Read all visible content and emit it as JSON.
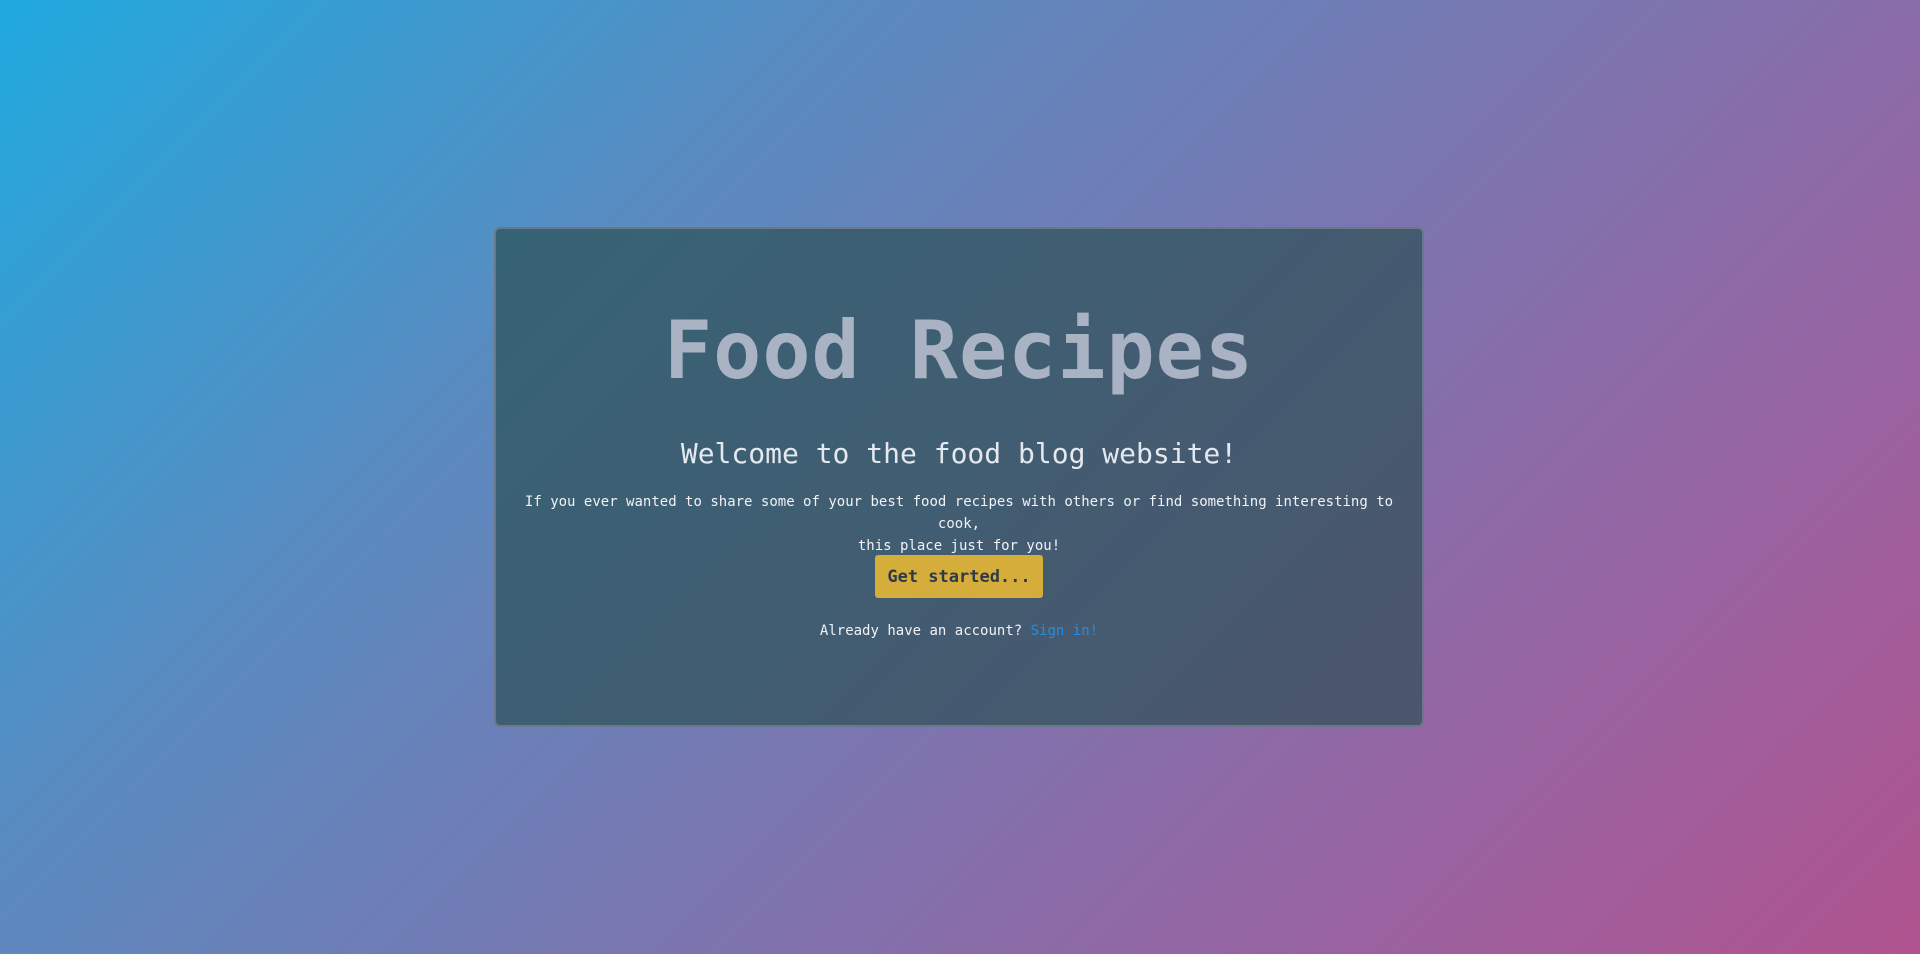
{
  "hero": {
    "title": "Food Recipes",
    "subtitle": "Welcome to the food blog website!",
    "description_line1": "If you ever wanted to share some of your best food recipes with others or find something interesting to cook,",
    "description_line2": "this place just for you!",
    "cta_label": "Get started...",
    "signin_prompt": "Already have an account?",
    "signin_link": "Sign in!"
  },
  "colors": {
    "cta_background": "#d4ad3a",
    "link": "#1e8fe6",
    "title": "#aab3c4"
  }
}
